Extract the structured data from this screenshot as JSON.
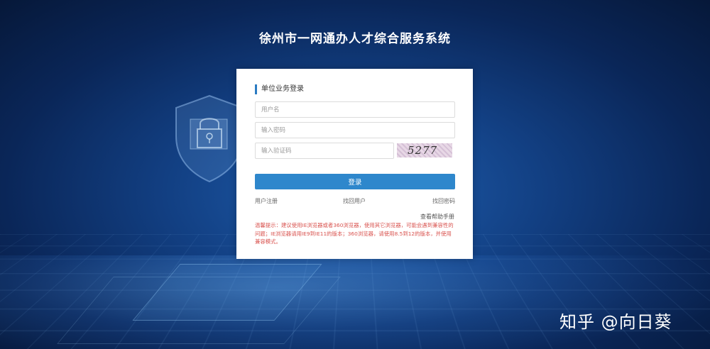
{
  "page": {
    "title": "徐州市一网通办人才综合服务系统"
  },
  "login": {
    "heading": "单位业务登录",
    "username_placeholder": "用户名",
    "password_placeholder": "输入密码",
    "captcha_placeholder": "输入验证码",
    "captcha_text": "5277",
    "login_label": "登录",
    "register_label": "用户注册",
    "recover_user_label": "找回用户",
    "recover_password_label": "找回密码",
    "help_label": "查看帮助手册",
    "tip": "温馨提示：建议使用IE浏览器或者360浏览器，使用其它浏览器，可能会遇到兼容性的问题；IE浏览器请用IE9到IE11的版本；360浏览器，请使用8.5到12的版本，并使用兼容模式。"
  },
  "watermark": "知乎 @向日葵",
  "colors": {
    "accent": "#2e87cc",
    "tip": "#d9534f",
    "background": "#0a2658"
  }
}
